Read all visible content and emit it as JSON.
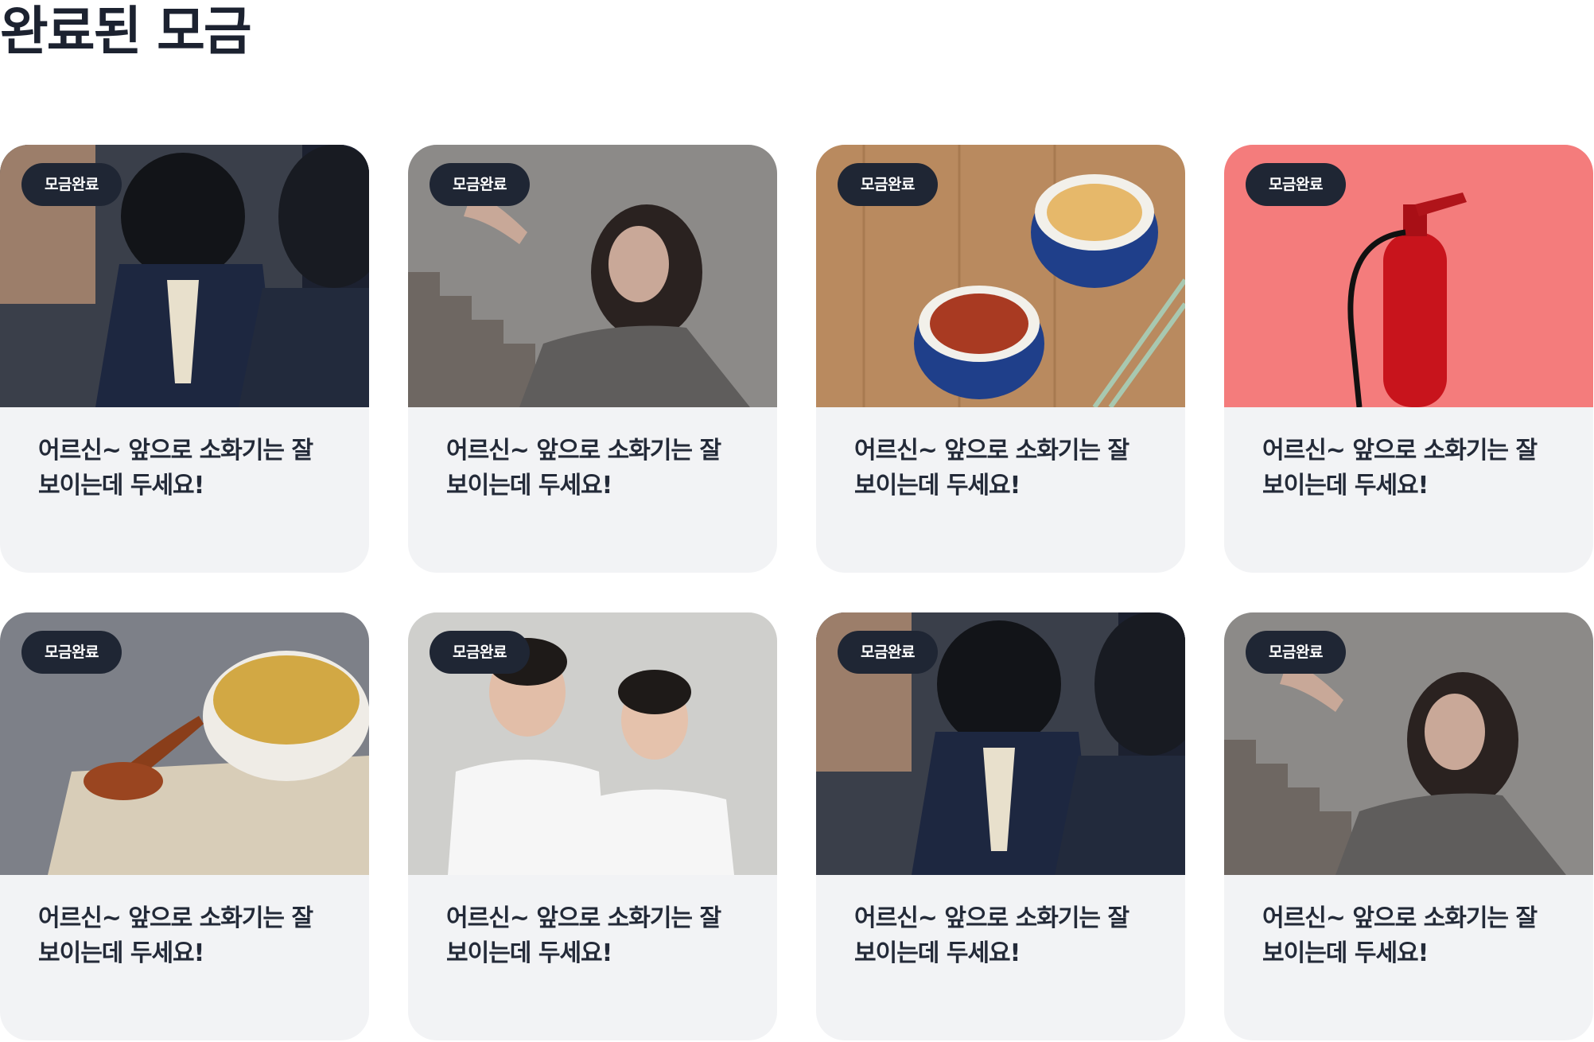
{
  "page": {
    "title": "완료된 모금"
  },
  "cards": [
    {
      "badge": "모금완료",
      "title": "어르신~ 앞으로 소화기는 잘 보이는데 두세요!",
      "image": "students-bowing-photo"
    },
    {
      "badge": "모금완료",
      "title": "어르신~ 앞으로 소화기는 잘 보이는데 두세요!",
      "image": "girl-on-stairs-photo"
    },
    {
      "badge": "모금완료",
      "title": "어르신~ 앞으로 소화기는 잘 보이는데 두세요!",
      "image": "lunchbox-food-photo"
    },
    {
      "badge": "모금완료",
      "title": "어르신~ 앞으로 소화기는 잘 보이는데 두세요!",
      "image": "fire-extinguisher-photo"
    },
    {
      "badge": "모금완료",
      "title": "어르신~ 앞으로 소화기는 잘 보이는데 두세요!",
      "image": "porridge-bowl-photo"
    },
    {
      "badge": "모금완료",
      "title": "어르신~ 앞으로 소화기는 잘 보이는데 두세요!",
      "image": "clear-mask-couple-photo"
    },
    {
      "badge": "모금완료",
      "title": "어르신~ 앞으로 소화기는 잘 보이는데 두세요!",
      "image": "students-bowing-photo"
    },
    {
      "badge": "모금완료",
      "title": "어르신~ 앞으로 소화기는 잘 보이는데 두세요!",
      "image": "girl-on-stairs-photo"
    }
  ],
  "colors": {
    "badge_bg": "#1f2634",
    "card_bg": "#f2f3f5",
    "title_text": "#1c2230"
  }
}
